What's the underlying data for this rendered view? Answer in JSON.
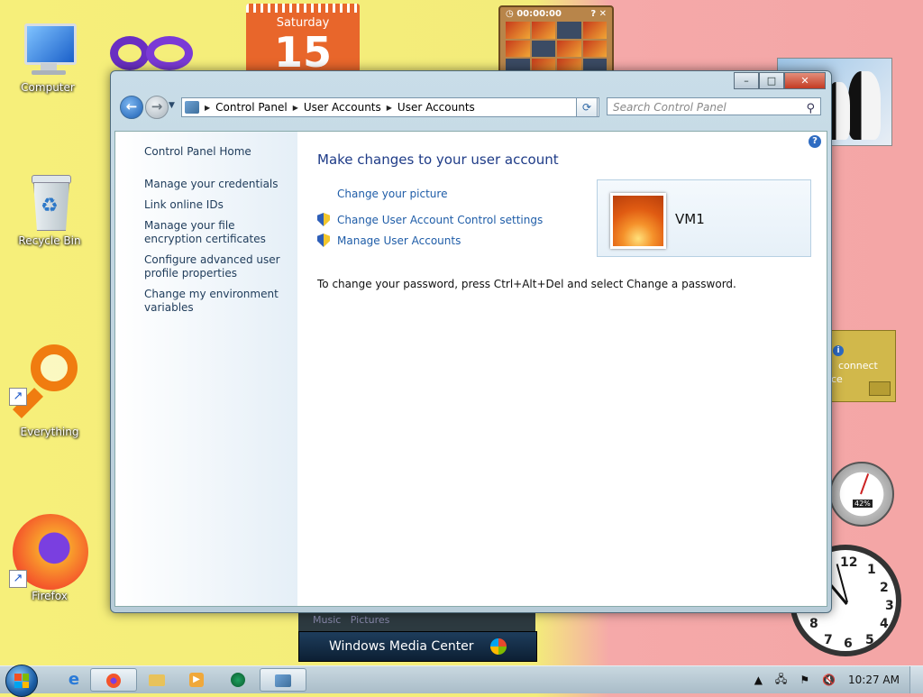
{
  "desktop": {
    "icons": [
      {
        "label": "Computer"
      },
      {
        "label": "Recycle Bin"
      },
      {
        "label": "Everything"
      },
      {
        "label": "Firefox"
      }
    ]
  },
  "gadgets": {
    "calendar": {
      "day_name": "Saturday",
      "day_number": "15"
    },
    "puzzle": {
      "timer": "00:00:00"
    },
    "feed": {
      "text_line1": "connect",
      "text_line2": "ce"
    },
    "cpu": {
      "value": "42%"
    },
    "clock": {
      "numbers": [
        "12",
        "1",
        "2",
        "3",
        "4",
        "5",
        "6",
        "7",
        "8"
      ]
    },
    "media_center": {
      "label": "Windows Media Center",
      "strip_label": "Music   Pictures"
    }
  },
  "window": {
    "title_buttons": {
      "minimize": "–",
      "maximize": "□",
      "close": "✕"
    },
    "nav": {
      "breadcrumbs": [
        "Control Panel",
        "User Accounts",
        "User Accounts"
      ],
      "search_placeholder": "Search Control Panel"
    },
    "left_pane": {
      "home": "Control Panel Home",
      "links": [
        "Manage your credentials",
        "Link online IDs",
        "Manage your file encryption certificates",
        "Configure advanced user profile properties",
        "Change my environment variables"
      ]
    },
    "main": {
      "title": "Make changes to your user account",
      "tasks": [
        "Change your picture",
        "Change User Account Control settings",
        "Manage User Accounts"
      ],
      "password_note": "To change your password, press Ctrl+Alt+Del and select Change a password.",
      "user": {
        "name": "VM1"
      }
    }
  },
  "taskbar": {
    "clock": "10:27 AM"
  },
  "colors": {
    "link": "#1f5da8",
    "title": "#1e3b87",
    "desktop_left": "#f6ef7a",
    "desktop_right": "#f4a6a6"
  }
}
